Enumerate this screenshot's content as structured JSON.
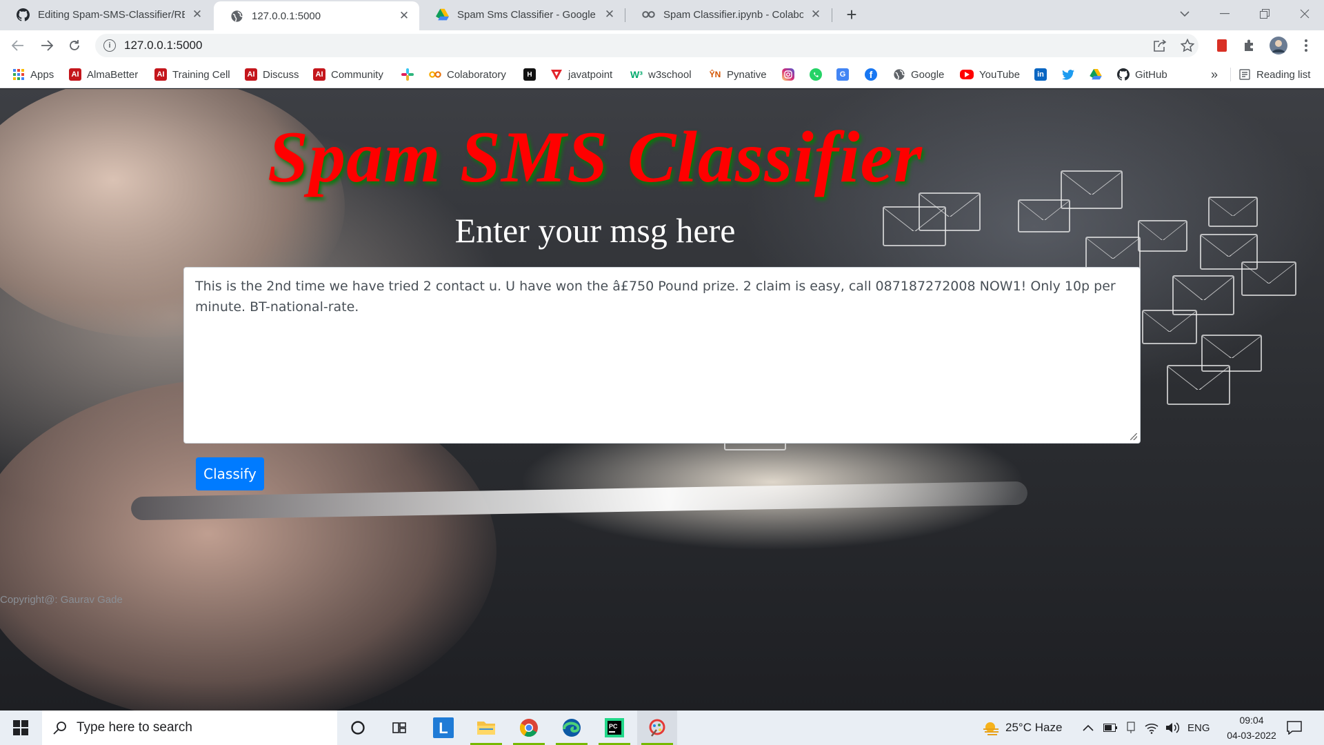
{
  "browser": {
    "tabs": [
      {
        "title": "Editing Spam-SMS-Classifier/README.md",
        "icon": "github-icon"
      },
      {
        "title": "127.0.0.1:5000",
        "icon": "globe-icon"
      },
      {
        "title": "Spam Sms Classifier - Google Drive",
        "icon": "google-drive-icon"
      },
      {
        "title": "Spam Classifier.ipynb - Colaboratory",
        "icon": "colab-icon"
      }
    ],
    "url": "127.0.0.1:5000",
    "bookmarks": [
      {
        "label": "Apps",
        "icon": "apps-grid-icon"
      },
      {
        "label": "AlmaBetter",
        "icon": "almabetter-icon"
      },
      {
        "label": "Training Cell",
        "icon": "almabetter-icon"
      },
      {
        "label": "Discuss",
        "icon": "almabetter-icon"
      },
      {
        "label": "Community",
        "icon": "almabetter-icon"
      },
      {
        "label": "",
        "icon": "slack-icon"
      },
      {
        "label": "Colaboratory",
        "icon": "colab-icon"
      },
      {
        "label": "",
        "icon": "hackerrank-icon"
      },
      {
        "label": "javatpoint",
        "icon": "javatpoint-icon"
      },
      {
        "label": "w3school",
        "icon": "w3schools-icon"
      },
      {
        "label": "Pynative",
        "icon": "pynative-icon"
      },
      {
        "label": "",
        "icon": "instagram-icon"
      },
      {
        "label": "",
        "icon": "whatsapp-icon"
      },
      {
        "label": "",
        "icon": "translate-icon"
      },
      {
        "label": "",
        "icon": "facebook-icon"
      },
      {
        "label": "Google",
        "icon": "globe-icon"
      },
      {
        "label": "YouTube",
        "icon": "youtube-icon"
      },
      {
        "label": "",
        "icon": "linkedin-icon"
      },
      {
        "label": "",
        "icon": "twitter-icon"
      },
      {
        "label": "",
        "icon": "google-drive-icon"
      },
      {
        "label": "GitHub",
        "icon": "github-icon"
      }
    ],
    "reading_list": "Reading list",
    "overflow": "»"
  },
  "page": {
    "title": "Spam SMS Classifier",
    "subtitle": "Enter your msg here",
    "message": "This is the 2nd time we have tried 2 contact u. U have won the â£750 Pound prize. 2 claim is easy, call 087187272008 NOW1! Only 10p per minute. BT-national-rate.",
    "button": "Classify",
    "copyright": "Copyright@: Gaurav Gade",
    "colors": {
      "title": "#ff0000",
      "title_shadow": "#0a7a0a",
      "button": "#007bff"
    }
  },
  "taskbar": {
    "search_placeholder": "Type here to search",
    "weather": "25°C  Haze",
    "language": "ENG",
    "time": "09:04",
    "date": "04-03-2022",
    "apps": [
      "cortana-icon",
      "task-view-icon",
      "l-app-icon",
      "file-explorer-icon",
      "chrome-icon",
      "edge-icon",
      "pycharm-icon",
      "paint-app-icon"
    ]
  }
}
